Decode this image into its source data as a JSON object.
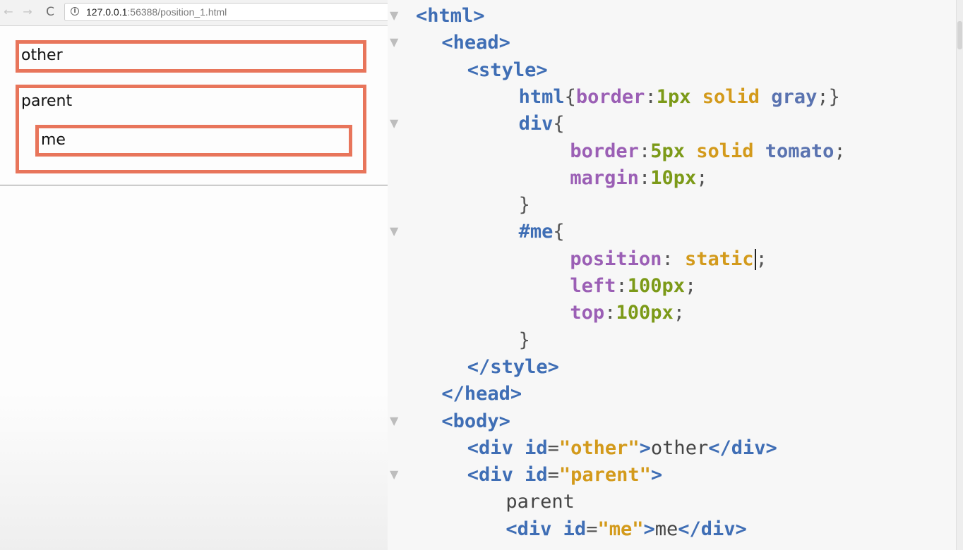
{
  "browser": {
    "nav": {
      "back": "←",
      "forward": "→",
      "reload": "C"
    },
    "info": "i",
    "url_host": "127.0.0.1",
    "url_path": ":56388/position_1.html"
  },
  "page": {
    "other_text": "other",
    "parent_text": "parent",
    "me_text": "me"
  },
  "editor": {
    "lines": [
      {
        "indent": "",
        "tokens": [
          [
            "tag",
            "<html>"
          ]
        ]
      },
      {
        "indent": "  ",
        "tokens": [
          [
            "tag",
            "<head>"
          ]
        ]
      },
      {
        "indent": "    ",
        "tokens": [
          [
            "tag",
            "<style>"
          ]
        ]
      },
      {
        "indent": "        ",
        "tokens": [
          [
            "tag",
            "html"
          ],
          [
            "pun",
            "{"
          ],
          [
            "prop",
            "border"
          ],
          [
            "pun",
            ":"
          ],
          [
            "num",
            "1px"
          ],
          [
            "pun",
            " "
          ],
          [
            "val",
            "solid"
          ],
          [
            "pun",
            " "
          ],
          [
            "kw",
            "gray"
          ],
          [
            "pun",
            ";}"
          ]
        ]
      },
      {
        "indent": "        ",
        "tokens": [
          [
            "tag",
            "div"
          ],
          [
            "pun",
            "{"
          ]
        ]
      },
      {
        "indent": "            ",
        "tokens": [
          [
            "prop",
            "border"
          ],
          [
            "pun",
            ":"
          ],
          [
            "num",
            "5px"
          ],
          [
            "pun",
            " "
          ],
          [
            "val",
            "solid"
          ],
          [
            "pun",
            " "
          ],
          [
            "kw",
            "tomato"
          ],
          [
            "pun",
            ";"
          ]
        ]
      },
      {
        "indent": "            ",
        "tokens": [
          [
            "prop",
            "margin"
          ],
          [
            "pun",
            ":"
          ],
          [
            "num",
            "10px"
          ],
          [
            "pun",
            ";"
          ]
        ]
      },
      {
        "indent": "        ",
        "tokens": [
          [
            "pun",
            "}"
          ]
        ]
      },
      {
        "indent": "        ",
        "tokens": [
          [
            "id",
            "#me"
          ],
          [
            "pun",
            "{"
          ]
        ]
      },
      {
        "indent": "            ",
        "tokens": [
          [
            "prop",
            "position"
          ],
          [
            "pun",
            ": "
          ],
          [
            "val",
            "static"
          ],
          [
            "caret",
            ""
          ],
          [
            "pun",
            ";"
          ]
        ]
      },
      {
        "indent": "            ",
        "tokens": [
          [
            "prop",
            "left"
          ],
          [
            "pun",
            ":"
          ],
          [
            "num",
            "100px"
          ],
          [
            "pun",
            ";"
          ]
        ]
      },
      {
        "indent": "            ",
        "tokens": [
          [
            "prop",
            "top"
          ],
          [
            "pun",
            ":"
          ],
          [
            "num",
            "100px"
          ],
          [
            "pun",
            ";"
          ]
        ]
      },
      {
        "indent": "        ",
        "tokens": [
          [
            "pun",
            "}"
          ]
        ]
      },
      {
        "indent": "    ",
        "tokens": [
          [
            "tag",
            "</style>"
          ]
        ]
      },
      {
        "indent": "  ",
        "tokens": [
          [
            "tag",
            "</head>"
          ]
        ]
      },
      {
        "indent": "  ",
        "tokens": [
          [
            "tag",
            "<body>"
          ]
        ]
      },
      {
        "indent": "    ",
        "tokens": [
          [
            "tag",
            "<div "
          ],
          [
            "attr",
            "id"
          ],
          [
            "pun",
            "="
          ],
          [
            "str",
            "\"other\""
          ],
          [
            "tag",
            ">"
          ],
          [
            "txt",
            "other"
          ],
          [
            "tag",
            "</div>"
          ]
        ]
      },
      {
        "indent": "    ",
        "tokens": [
          [
            "tag",
            "<div "
          ],
          [
            "attr",
            "id"
          ],
          [
            "pun",
            "="
          ],
          [
            "str",
            "\"parent\""
          ],
          [
            "tag",
            ">"
          ]
        ]
      },
      {
        "indent": "       ",
        "tokens": [
          [
            "txt",
            "parent"
          ]
        ]
      },
      {
        "indent": "       ",
        "tokens": [
          [
            "tag",
            "<div "
          ],
          [
            "attr",
            "id"
          ],
          [
            "pun",
            "="
          ],
          [
            "str",
            "\"me\""
          ],
          [
            "tag",
            ">"
          ],
          [
            "txt",
            "me"
          ],
          [
            "tag",
            "</div>"
          ]
        ]
      }
    ],
    "fold_marker": "▼"
  },
  "colors": {
    "tomato": "#e8755b",
    "editor_bg": "#f7f7f7"
  }
}
